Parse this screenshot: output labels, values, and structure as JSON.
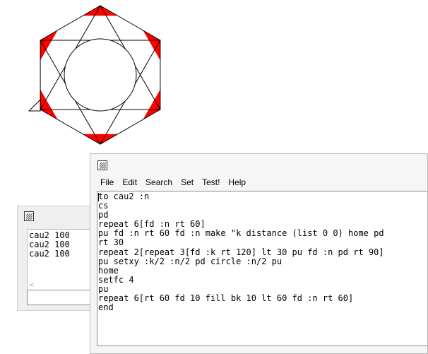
{
  "drawing": {
    "fill_color": "#ff0000",
    "stroke_color": "#000000"
  },
  "listener": {
    "icon": "logo-window-icon",
    "history": [
      "cau2 100",
      "cau2 100",
      "cau2 100"
    ],
    "scroll_left_glyph": "<",
    "command_value": ""
  },
  "editor": {
    "icon": "logo-window-icon",
    "menu": [
      "File",
      "Edit",
      "Search",
      "Set",
      "Test!",
      "Help"
    ],
    "code_lines": [
      "to cau2 :n",
      "cs",
      "pd",
      "repeat 6[fd :n rt 60]",
      "pu fd :n rt 60 fd :n make \"k distance (list 0 0) home pd",
      "rt 30",
      "repeat 2[repeat 3[fd :k rt 120] lt 30 pu fd :n pd rt 90]",
      "pu setxy :k/2 :n/2 pd circle :n/2 pu",
      "home",
      "setfc 4",
      "pu",
      "repeat 6[rt 60 fd 10 fill bk 10 lt 60 fd :n rt 60]",
      "end"
    ]
  }
}
